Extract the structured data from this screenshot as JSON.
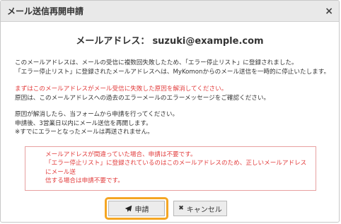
{
  "dialog": {
    "title": "メール送信再開申請",
    "close_glyph": "×"
  },
  "email": {
    "label": "メールアドレス：",
    "address": "suzuki@example.com"
  },
  "paragraph1": [
    "このメールアドレスは、メールの受信に複数回失敗したため、「エラー停止リスト」に登録されました。",
    "「エラー停止リスト」に登録されたメールアドレスへは、MyKomonからのメール送信を一時的に停止いたします。"
  ],
  "paragraph2": {
    "red_line": "まずはこのメールアドレスがメール受信に失敗した原因を解消してください。",
    "line": "原因は、このメールアドレスへの過去のエラーメールのエラーメッセージをご確認ください。"
  },
  "paragraph3": [
    "原因が解消したら、当フォームから申請を行ってください。",
    "申請後、3営業日以内にメール送信を再開します。",
    "※すでにエラーとなったメールは再送されません。"
  ],
  "alert": [
    "メールアドレスが間違っていた場合、申請は不要です。",
    "「エラー停止リスト」に登録されているのはこのメールアドレスのため、正しいメールアドレスにメール送",
    "信する場合は申請不要です。"
  ],
  "buttons": {
    "submit_label": "申請",
    "submit_icon": "paper-plane-icon",
    "cancel_label": "キャンセル",
    "cancel_glyph": "✖"
  },
  "colors": {
    "highlight": "#f5a623",
    "alert_text": "#e23c3c",
    "alert_border": "#e8a0a0"
  }
}
